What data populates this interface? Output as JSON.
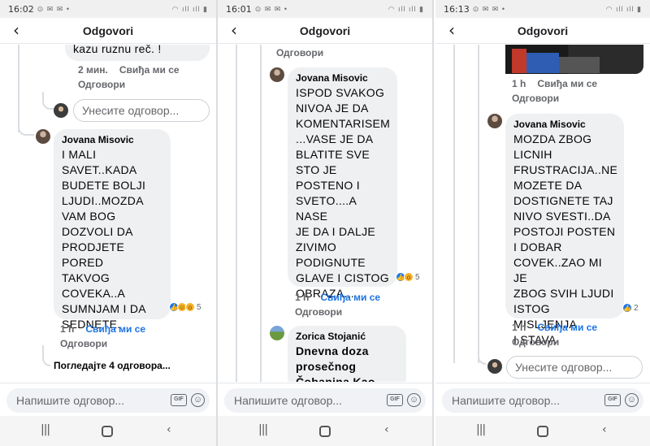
{
  "screens": [
    {
      "status_time": "16:02",
      "header_title": "Odgovori",
      "prev_comment": {
        "text": "kazu ruznu reč. !",
        "time": "2 мин.",
        "like": "Свиђа ми се",
        "reply": "Одговори"
      },
      "reply_placeholder": "Унесите одговор...",
      "comment": {
        "author": "Jovana Misovic",
        "text": "I MALI\nSAVET..KADA\nBUDETE BOLJI\nLJUDI..MOZDA\nVAM BOG\nDOZVOLI DA\nPRODJETE PORED\nTAKVOG\nCOVEKA..A\nSUMNJAM I DA\nSEDNETE.",
        "reaction_count": "5",
        "time": "1 h",
        "like": "Свиђа ми се",
        "reply": "Одговори"
      },
      "view_more": "Погледајте 4 одговора...",
      "composer_placeholder": "Напишите одговор...",
      "gif_label": "GIF"
    },
    {
      "status_time": "16:01",
      "header_title": "Odgovori",
      "prev_reply": "Одговори",
      "comment": {
        "author": "Jovana Misovic",
        "text": "ISPOD SVAKOG\nNIVOA JE DA\nKOMENTARISEM\n...VASE JE DA\nBLATITE SVE\nSTO JE\nPOSTENO I\nSVETO....A NASE\nJE DA I DALJE\nZIVIMO\nPODIGNUTE\nGLAVE I CISTOG\nOBRAZA...",
        "reaction_count": "5",
        "time": "1 h",
        "like": "Свиђа ми се",
        "reply": "Одговори"
      },
      "next_comment": {
        "author": "Zorica Stojanić",
        "text": "Dnevna doza\nprosečnog\nČobanina Kao"
      },
      "composer_placeholder": "Напишите одговор...",
      "gif_label": "GIF"
    },
    {
      "status_time": "16:13",
      "header_title": "Odgovori",
      "prev_comment": {
        "time": "1 h",
        "like": "Свиђа ми се",
        "reply": "Одговори"
      },
      "comment": {
        "author": "Jovana Misovic",
        "text": "MOZDA ZBOG\nLICNIH\nFRUSTRACIJA..NE\nMOZETE DA\nDOSTIGNETE TAJ\nNIVO SVESTI..DA\nPOSTOJI POSTEN\nI DOBAR\nCOVEK..ZAO MI JE\nZBOG SVIH LJUDI\nISTOG MISLJENJA\nI STAVA.",
        "reaction_count": "2",
        "time": "1 h",
        "like": "Свиђа ми се",
        "reply": "Одговори"
      },
      "reply_placeholder": "Унесите одговор...",
      "composer_placeholder": "Напишите одговор...",
      "gif_label": "GIF"
    }
  ],
  "icons": {
    "back": "back-arrow-icon",
    "emoji": "emoji-icon",
    "gif": "gif-icon",
    "recents": "recent-apps-icon",
    "home": "home-icon",
    "nav_back": "nav-back-icon"
  },
  "colors": {
    "link_blue": "#1b74e4",
    "bubble": "#eff0f2",
    "meta_grey": "#65676b"
  }
}
